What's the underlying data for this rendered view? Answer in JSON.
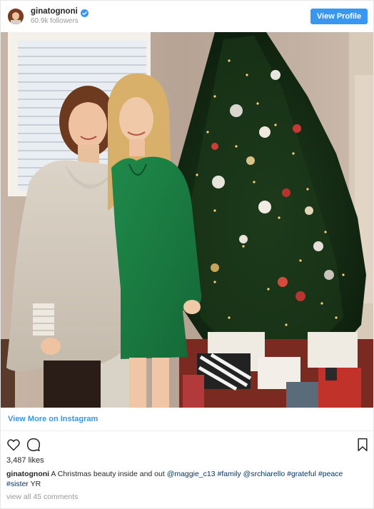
{
  "header": {
    "username": "ginatognoni",
    "followers": "60.9k followers",
    "view_profile_label": "View Profile",
    "verified": true
  },
  "post": {
    "view_more_label": "View More on Instagram",
    "likes": "3,487 likes",
    "caption": {
      "username": "ginatognoni",
      "text": "A Christmas beauty inside and out",
      "mention_1": "@maggie_c13",
      "tag_family": "#family",
      "mention_2": "@srchiarello",
      "tag_grateful": "#grateful",
      "tag_peace": "#peace",
      "tag_sister": "#sister",
      "trailing": "YR"
    },
    "comments_label": "view all 45 comments"
  },
  "icons": {
    "like": "heart-icon",
    "comment": "comment-icon",
    "save": "bookmark-icon",
    "verified": "verified-badge-icon"
  },
  "colors": {
    "accent": "#3897f0",
    "hashtag": "#003569",
    "muted": "#999999"
  }
}
